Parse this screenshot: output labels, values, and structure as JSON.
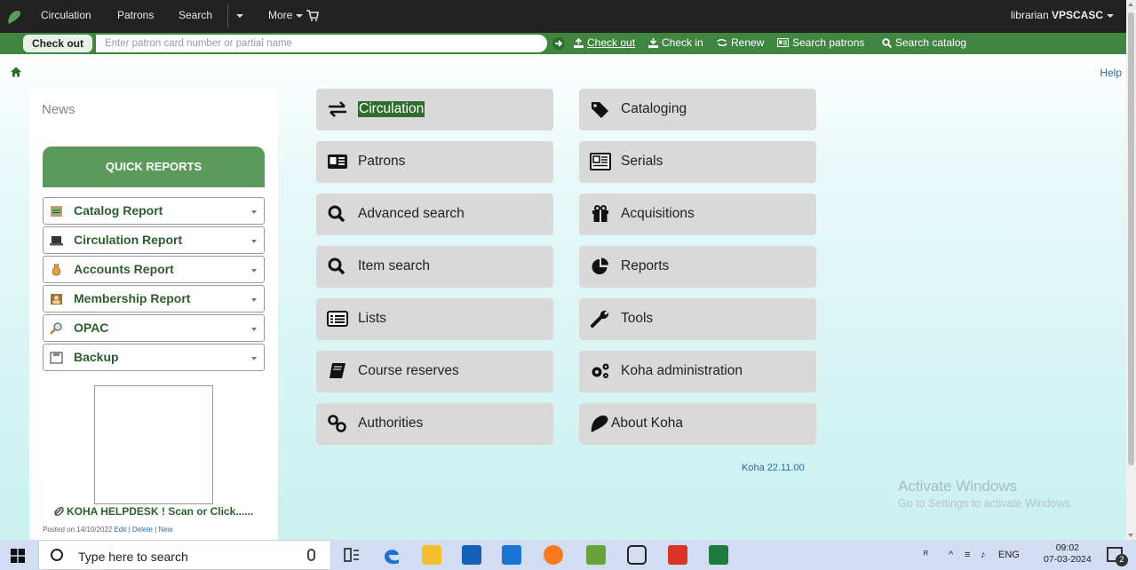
{
  "topnav": {
    "links": [
      "Circulation",
      "Patrons",
      "Search",
      "More"
    ],
    "user_role": "librarian",
    "user_branch": "VPSCASC"
  },
  "checkout_bar": {
    "tab_label": "Check out",
    "input_placeholder": "Enter patron card number or partial name",
    "actions": [
      "Check out",
      "Check in",
      "Renew",
      "Search patrons",
      "Search catalog"
    ]
  },
  "help_label": "Help",
  "sidebar": {
    "news_title": "News",
    "quick_reports_title": "QUICK REPORTS",
    "reports": [
      {
        "label": "Catalog Report",
        "icon": "catalog-book-icon"
      },
      {
        "label": "Circulation Report",
        "icon": "laptop-icon"
      },
      {
        "label": "Accounts Report",
        "icon": "money-bag-icon"
      },
      {
        "label": "Membership Report",
        "icon": "membership-card-icon"
      },
      {
        "label": "OPAC",
        "icon": "magnifier-icon"
      },
      {
        "label": "Backup",
        "icon": "floppy-disk-icon"
      }
    ],
    "helpdesk_text": "KOHA HELPDESK ! Scan or Click......",
    "posted_on": "Posted on 14/10/2022",
    "post_links": [
      "Edit",
      "Delete",
      "New"
    ]
  },
  "modules": {
    "left": [
      "Circulation",
      "Patrons",
      "Advanced search",
      "Item search",
      "Lists",
      "Course reserves",
      "Authorities"
    ],
    "right": [
      "Cataloging",
      "Serials",
      "Acquisitions",
      "Reports",
      "Tools",
      "Koha administration",
      "About Koha"
    ]
  },
  "version_label": "Koha 22.11.00",
  "watermark": {
    "title": "Activate Windows",
    "subtitle": "Go to Settings to activate Windows."
  },
  "taskbar": {
    "search_placeholder": "Type here to search",
    "language": "ENG",
    "time": "09:02",
    "date": "07-03-2024",
    "notification_count": "2"
  }
}
